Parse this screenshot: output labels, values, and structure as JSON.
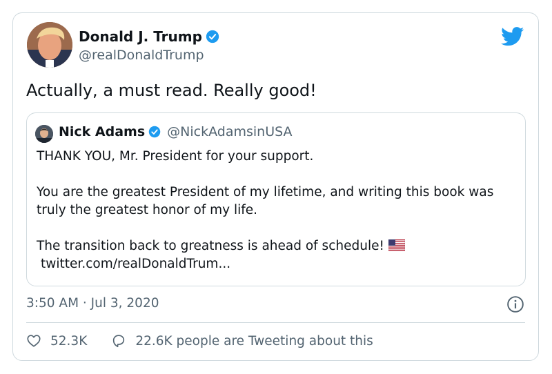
{
  "tweet": {
    "author_name": "Donald J. Trump",
    "author_handle": "@realDonaldTrump",
    "text": "Actually, a must read. Really good!",
    "timestamp": "3:50 AM · Jul 3, 2020",
    "likes": "52.3K",
    "retweets_text": "22.6K people are Tweeting about this"
  },
  "quoted": {
    "author_name": "Nick Adams",
    "author_handle": "@NickAdamsinUSA",
    "line1": "THANK YOU, Mr. President for your support.",
    "line2": "You are the greatest President of my lifetime, and writing this book was truly the greatest honor of my life.",
    "line3": "The transition back to greatness is ahead of schedule!",
    "link": "twitter.com/realDonaldTrum..."
  },
  "icons": {
    "brand": "twitter-bird-icon",
    "verified": "verified-badge-icon",
    "like": "heart-icon",
    "reply": "speech-bubble-icon",
    "info": "info-icon",
    "flag": "us-flag-icon"
  },
  "colors": {
    "brand_blue": "#1d9bf0",
    "text": "#0f1419",
    "secondary": "#536471",
    "border": "#cfd9de"
  }
}
